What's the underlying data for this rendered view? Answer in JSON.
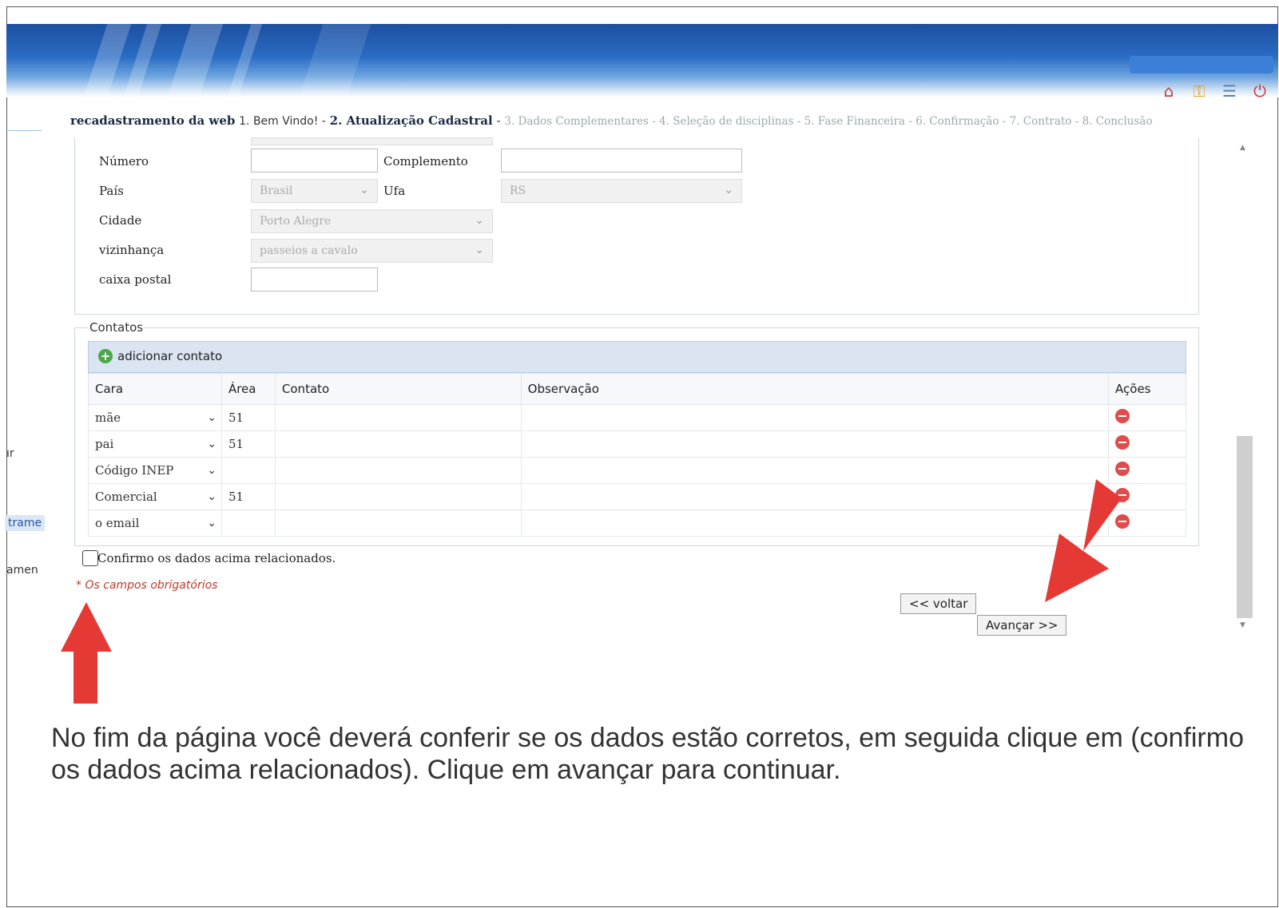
{
  "breadcrumb": {
    "title": "recadastramento da web",
    "steps_done": "1. Bem Vindo! -",
    "current": "2. Atualização Cadastral",
    "separator": "-",
    "steps_next": "3. Dados Complementares - 4. Seleção de disciplinas - 5. Fase Financeira - 6. Confirmação - 7. Contrato - 8. Conclusão"
  },
  "sidebar_fragments": [
    "ır",
    "trame",
    "amen"
  ],
  "address": {
    "numero_label": "Número",
    "complemento_label": "Complemento",
    "pais_label": "País",
    "pais_value": "Brasil",
    "ufa_label": "Ufa",
    "ufa_value": "RS",
    "cidade_label": "Cidade",
    "cidade_value": "Porto Alegre",
    "vizinhanca_label": "vizinhança",
    "vizinhanca_value": "passeios a cavalo",
    "caixa_label": "caixa postal"
  },
  "contacts": {
    "legend": "Contatos",
    "add_label": "adicionar contato",
    "columns": [
      "Cara",
      "Área",
      "Contato",
      "Observação",
      "Ações"
    ],
    "rows": [
      {
        "cara": "mãe",
        "area": "51"
      },
      {
        "cara": "pai",
        "area": "51"
      },
      {
        "cara": "Código INEP",
        "area": ""
      },
      {
        "cara": "Comercial",
        "area": "51"
      },
      {
        "cara": "o email",
        "area": ""
      }
    ]
  },
  "confirm_label": "Confirmo os dados acima relacionados.",
  "required_note": "* Os campos obrigatórios",
  "buttons": {
    "back": "<< voltar",
    "next": "Avançar >>"
  },
  "instruction": "No fim da página você deverá conferir se os dados estão corretos, em seguida clique em (confirmo os dados acima relacionados). Clique em avançar para continuar.",
  "colors": {
    "arrow": "#e53935",
    "banner": "#2a6cc4",
    "required": "#c0392b"
  }
}
